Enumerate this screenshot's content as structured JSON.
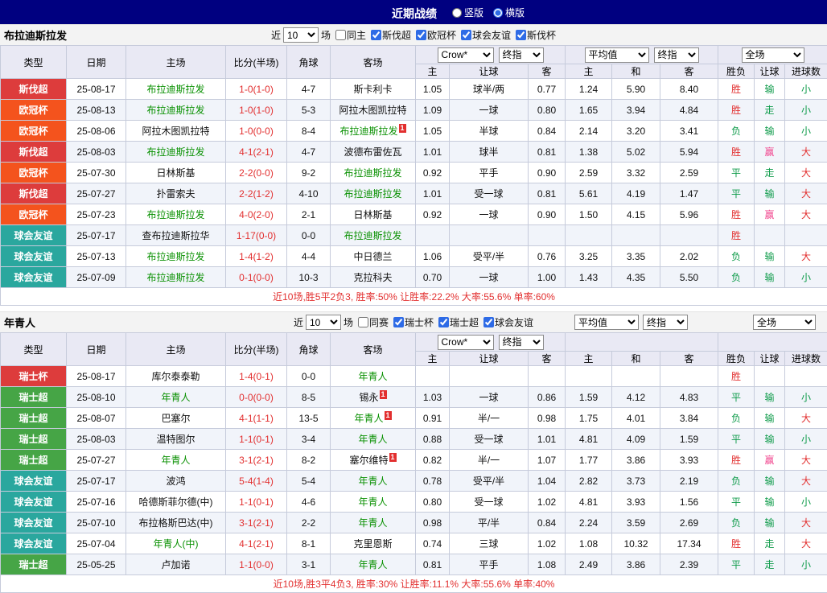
{
  "colors": {
    "R": "#e22f2f",
    "G": "#0e9b4a",
    "P": "#f1478f",
    "team_green": "#089000",
    "navy": "#000080",
    "header_bg": "#e9e9f4",
    "league": {
      "斯伐超": "#dd3c3c",
      "欧冠杯": "#f4531d",
      "球会友谊": "#2aa79e",
      "瑞士杯": "#dd3c3c",
      "瑞士超": "#46a546"
    }
  },
  "topbar": {
    "title": "近期战绩",
    "radios": [
      {
        "label": "竖版",
        "selected": false
      },
      {
        "label": "横版",
        "selected": true
      }
    ]
  },
  "header_labels": {
    "cols": [
      "类型",
      "日期",
      "主场",
      "比分(半场)",
      "角球",
      "客场"
    ],
    "sub": [
      "主",
      "让球",
      "客",
      "主",
      "和",
      "客",
      "胜负",
      "让球",
      "进球数"
    ]
  },
  "sections": [
    {
      "team": "布拉迪斯拉发",
      "filter": {
        "near": "近",
        "count": "10",
        "games": "场",
        "same": {
          "label": "同主",
          "checked": false
        },
        "leagues": [
          {
            "label": "斯伐超",
            "checked": true
          },
          {
            "label": "欧冠杯",
            "checked": true
          },
          {
            "label": "球会友谊",
            "checked": true
          },
          {
            "label": "斯伐杯",
            "checked": true
          }
        ]
      },
      "selects": {
        "odds": [
          "Crow*",
          "终指"
        ],
        "avg": [
          "平均值",
          "终指"
        ],
        "scope": [
          "全场"
        ],
        "avg_in_filter": false
      },
      "rows": [
        {
          "lg": "斯伐超",
          "date": "25-08-17",
          "home": {
            "name": "布拉迪斯拉发",
            "green": true
          },
          "score": "1-0(1-0)",
          "corners": "4-7",
          "away": {
            "name": "斯卡利卡"
          },
          "odds": [
            "1.05",
            "球半/两",
            "0.77"
          ],
          "avg": [
            "1.24",
            "5.90",
            "8.40"
          ],
          "results": [
            {
              "t": "胜",
              "c": "R"
            },
            {
              "t": "输",
              "c": "G"
            },
            {
              "t": "小",
              "c": "G"
            }
          ]
        },
        {
          "lg": "欧冠杯",
          "date": "25-08-13",
          "home": {
            "name": "布拉迪斯拉发",
            "green": true
          },
          "score": "1-0(1-0)",
          "corners": "5-3",
          "away": {
            "name": "阿拉木图凯拉特"
          },
          "odds": [
            "1.09",
            "一球",
            "0.80"
          ],
          "avg": [
            "1.65",
            "3.94",
            "4.84"
          ],
          "results": [
            {
              "t": "胜",
              "c": "R"
            },
            {
              "t": "走",
              "c": "G"
            },
            {
              "t": "小",
              "c": "G"
            }
          ]
        },
        {
          "lg": "欧冠杯",
          "date": "25-08-06",
          "home": {
            "name": "阿拉木图凯拉特"
          },
          "score": "1-0(0-0)",
          "corners": "8-4",
          "away": {
            "name": "布拉迪斯拉发",
            "green": true,
            "sup": "1"
          },
          "odds": [
            "1.05",
            "半球",
            "0.84"
          ],
          "avg": [
            "2.14",
            "3.20",
            "3.41"
          ],
          "results": [
            {
              "t": "负",
              "c": "G"
            },
            {
              "t": "输",
              "c": "G"
            },
            {
              "t": "小",
              "c": "G"
            }
          ]
        },
        {
          "lg": "斯伐超",
          "date": "25-08-03",
          "home": {
            "name": "布拉迪斯拉发",
            "green": true
          },
          "score": "4-1(2-1)",
          "corners": "4-7",
          "away": {
            "name": "波德布雷佐瓦"
          },
          "odds": [
            "1.01",
            "球半",
            "0.81"
          ],
          "avg": [
            "1.38",
            "5.02",
            "5.94"
          ],
          "results": [
            {
              "t": "胜",
              "c": "R"
            },
            {
              "t": "赢",
              "c": "P"
            },
            {
              "t": "大",
              "c": "R"
            }
          ]
        },
        {
          "lg": "欧冠杯",
          "date": "25-07-30",
          "home": {
            "name": "日林斯基"
          },
          "score": "2-2(0-0)",
          "corners": "9-2",
          "away": {
            "name": "布拉迪斯拉发",
            "green": true
          },
          "odds": [
            "0.92",
            "平手",
            "0.90"
          ],
          "avg": [
            "2.59",
            "3.32",
            "2.59"
          ],
          "results": [
            {
              "t": "平",
              "c": "G"
            },
            {
              "t": "走",
              "c": "G"
            },
            {
              "t": "大",
              "c": "R"
            }
          ]
        },
        {
          "lg": "斯伐超",
          "date": "25-07-27",
          "home": {
            "name": "扑雷索夫"
          },
          "score": "2-2(1-2)",
          "corners": "4-10",
          "away": {
            "name": "布拉迪斯拉发",
            "green": true
          },
          "odds": [
            "1.01",
            "受一球",
            "0.81"
          ],
          "avg": [
            "5.61",
            "4.19",
            "1.47"
          ],
          "results": [
            {
              "t": "平",
              "c": "G"
            },
            {
              "t": "输",
              "c": "G"
            },
            {
              "t": "大",
              "c": "R"
            }
          ]
        },
        {
          "lg": "欧冠杯",
          "date": "25-07-23",
          "home": {
            "name": "布拉迪斯拉发",
            "green": true
          },
          "score": "4-0(2-0)",
          "corners": "2-1",
          "away": {
            "name": "日林斯基"
          },
          "odds": [
            "0.92",
            "一球",
            "0.90"
          ],
          "avg": [
            "1.50",
            "4.15",
            "5.96"
          ],
          "results": [
            {
              "t": "胜",
              "c": "R"
            },
            {
              "t": "赢",
              "c": "P"
            },
            {
              "t": "大",
              "c": "R"
            }
          ]
        },
        {
          "lg": "球会友谊",
          "date": "25-07-17",
          "home": {
            "name": "查布拉迪斯拉华"
          },
          "score": "1-17(0-0)",
          "corners": "0-0",
          "away": {
            "name": "布拉迪斯拉发",
            "green": true
          },
          "odds": [
            "",
            "",
            ""
          ],
          "avg": [
            "",
            "",
            ""
          ],
          "results": [
            {
              "t": "胜",
              "c": "R"
            },
            {
              "t": "",
              "c": ""
            },
            {
              "t": "",
              "c": ""
            }
          ]
        },
        {
          "lg": "球会友谊",
          "date": "25-07-13",
          "home": {
            "name": "布拉迪斯拉发",
            "green": true
          },
          "score": "1-4(1-2)",
          "corners": "4-4",
          "away": {
            "name": "中日德兰"
          },
          "odds": [
            "1.06",
            "受平/半",
            "0.76"
          ],
          "avg": [
            "3.25",
            "3.35",
            "2.02"
          ],
          "results": [
            {
              "t": "负",
              "c": "G"
            },
            {
              "t": "输",
              "c": "G"
            },
            {
              "t": "大",
              "c": "R"
            }
          ]
        },
        {
          "lg": "球会友谊",
          "date": "25-07-09",
          "home": {
            "name": "布拉迪斯拉发",
            "green": true
          },
          "score": "0-1(0-0)",
          "corners": "10-3",
          "away": {
            "name": "克拉科夫"
          },
          "odds": [
            "0.70",
            "一球",
            "1.00"
          ],
          "avg": [
            "1.43",
            "4.35",
            "5.50"
          ],
          "results": [
            {
              "t": "负",
              "c": "G"
            },
            {
              "t": "输",
              "c": "G"
            },
            {
              "t": "小",
              "c": "G"
            }
          ]
        }
      ],
      "summary": "近10场,胜5平2负3, 胜率:50% 让胜率:22.2% 大率:55.6% 单率:60%"
    },
    {
      "team": "年青人",
      "filter": {
        "near": "近",
        "count": "10",
        "games": "场",
        "same": {
          "label": "同赛",
          "checked": false
        },
        "leagues": [
          {
            "label": "瑞士杯",
            "checked": true
          },
          {
            "label": "瑞士超",
            "checked": true
          },
          {
            "label": "球会友谊",
            "checked": true
          }
        ]
      },
      "selects": {
        "odds": [
          "Crow*",
          "终指"
        ],
        "avg": [
          "平均值",
          "终指"
        ],
        "scope": [
          "全场"
        ],
        "avg_in_filter": true
      },
      "rows": [
        {
          "lg": "瑞士杯",
          "date": "25-08-17",
          "home": {
            "name": "库尔泰泰勒"
          },
          "score": "1-4(0-1)",
          "corners": "0-0",
          "away": {
            "name": "年青人",
            "green": true
          },
          "odds": [
            "",
            "",
            ""
          ],
          "avg": [
            "",
            "",
            ""
          ],
          "results": [
            {
              "t": "胜",
              "c": "R"
            },
            {
              "t": "",
              "c": ""
            },
            {
              "t": "",
              "c": ""
            }
          ]
        },
        {
          "lg": "瑞士超",
          "date": "25-08-10",
          "home": {
            "name": "年青人",
            "green": true
          },
          "score": "0-0(0-0)",
          "corners": "8-5",
          "away": {
            "name": "锡永",
            "sup": "1"
          },
          "odds": [
            "1.03",
            "一球",
            "0.86"
          ],
          "avg": [
            "1.59",
            "4.12",
            "4.83"
          ],
          "results": [
            {
              "t": "平",
              "c": "G"
            },
            {
              "t": "输",
              "c": "G"
            },
            {
              "t": "小",
              "c": "G"
            }
          ]
        },
        {
          "lg": "瑞士超",
          "date": "25-08-07",
          "home": {
            "name": "巴塞尔"
          },
          "score": "4-1(1-1)",
          "corners": "13-5",
          "away": {
            "name": "年青人",
            "green": true,
            "sup": "1"
          },
          "odds": [
            "0.91",
            "半/一",
            "0.98"
          ],
          "avg": [
            "1.75",
            "4.01",
            "3.84"
          ],
          "results": [
            {
              "t": "负",
              "c": "G"
            },
            {
              "t": "输",
              "c": "G"
            },
            {
              "t": "大",
              "c": "R"
            }
          ]
        },
        {
          "lg": "瑞士超",
          "date": "25-08-03",
          "home": {
            "name": "温特图尔"
          },
          "score": "1-1(0-1)",
          "corners": "3-4",
          "away": {
            "name": "年青人",
            "green": true
          },
          "odds": [
            "0.88",
            "受一球",
            "1.01"
          ],
          "avg": [
            "4.81",
            "4.09",
            "1.59"
          ],
          "results": [
            {
              "t": "平",
              "c": "G"
            },
            {
              "t": "输",
              "c": "G"
            },
            {
              "t": "小",
              "c": "G"
            }
          ]
        },
        {
          "lg": "瑞士超",
          "date": "25-07-27",
          "home": {
            "name": "年青人",
            "green": true
          },
          "score": "3-1(2-1)",
          "corners": "8-2",
          "away": {
            "name": "塞尔维特",
            "sup": "1"
          },
          "odds": [
            "0.82",
            "半/一",
            "1.07"
          ],
          "avg": [
            "1.77",
            "3.86",
            "3.93"
          ],
          "results": [
            {
              "t": "胜",
              "c": "R"
            },
            {
              "t": "赢",
              "c": "P"
            },
            {
              "t": "大",
              "c": "R"
            }
          ]
        },
        {
          "lg": "球会友谊",
          "date": "25-07-17",
          "home": {
            "name": "波鸿"
          },
          "score": "5-4(1-4)",
          "corners": "5-4",
          "away": {
            "name": "年青人",
            "green": true
          },
          "odds": [
            "0.78",
            "受平/半",
            "1.04"
          ],
          "avg": [
            "2.82",
            "3.73",
            "2.19"
          ],
          "results": [
            {
              "t": "负",
              "c": "G"
            },
            {
              "t": "输",
              "c": "G"
            },
            {
              "t": "大",
              "c": "R"
            }
          ]
        },
        {
          "lg": "球会友谊",
          "date": "25-07-16",
          "home": {
            "name": "哈德斯菲尔德(中)"
          },
          "score": "1-1(0-1)",
          "corners": "4-6",
          "away": {
            "name": "年青人",
            "green": true
          },
          "odds": [
            "0.80",
            "受一球",
            "1.02"
          ],
          "avg": [
            "4.81",
            "3.93",
            "1.56"
          ],
          "results": [
            {
              "t": "平",
              "c": "G"
            },
            {
              "t": "输",
              "c": "G"
            },
            {
              "t": "小",
              "c": "G"
            }
          ]
        },
        {
          "lg": "球会友谊",
          "date": "25-07-10",
          "home": {
            "name": "布拉格斯巴达(中)"
          },
          "score": "3-1(2-1)",
          "corners": "2-2",
          "away": {
            "name": "年青人",
            "green": true
          },
          "odds": [
            "0.98",
            "平/半",
            "0.84"
          ],
          "avg": [
            "2.24",
            "3.59",
            "2.69"
          ],
          "results": [
            {
              "t": "负",
              "c": "G"
            },
            {
              "t": "输",
              "c": "G"
            },
            {
              "t": "大",
              "c": "R"
            }
          ]
        },
        {
          "lg": "球会友谊",
          "date": "25-07-04",
          "home": {
            "name": "年青人(中)",
            "green": true
          },
          "score": "4-1(2-1)",
          "corners": "8-1",
          "away": {
            "name": "克里恩斯"
          },
          "odds": [
            "0.74",
            "三球",
            "1.02"
          ],
          "avg": [
            "1.08",
            "10.32",
            "17.34"
          ],
          "results": [
            {
              "t": "胜",
              "c": "R"
            },
            {
              "t": "走",
              "c": "G"
            },
            {
              "t": "大",
              "c": "R"
            }
          ]
        },
        {
          "lg": "瑞士超",
          "date": "25-05-25",
          "home": {
            "name": "卢加诺"
          },
          "score": "1-1(0-0)",
          "corners": "3-1",
          "away": {
            "name": "年青人",
            "green": true
          },
          "odds": [
            "0.81",
            "平手",
            "1.08"
          ],
          "avg": [
            "2.49",
            "3.86",
            "2.39"
          ],
          "results": [
            {
              "t": "平",
              "c": "G"
            },
            {
              "t": "走",
              "c": "G"
            },
            {
              "t": "小",
              "c": "G"
            }
          ]
        }
      ],
      "summary": "近10场,胜3平4负3, 胜率:30% 让胜率:11.1% 大率:55.6% 单率:40%"
    }
  ]
}
